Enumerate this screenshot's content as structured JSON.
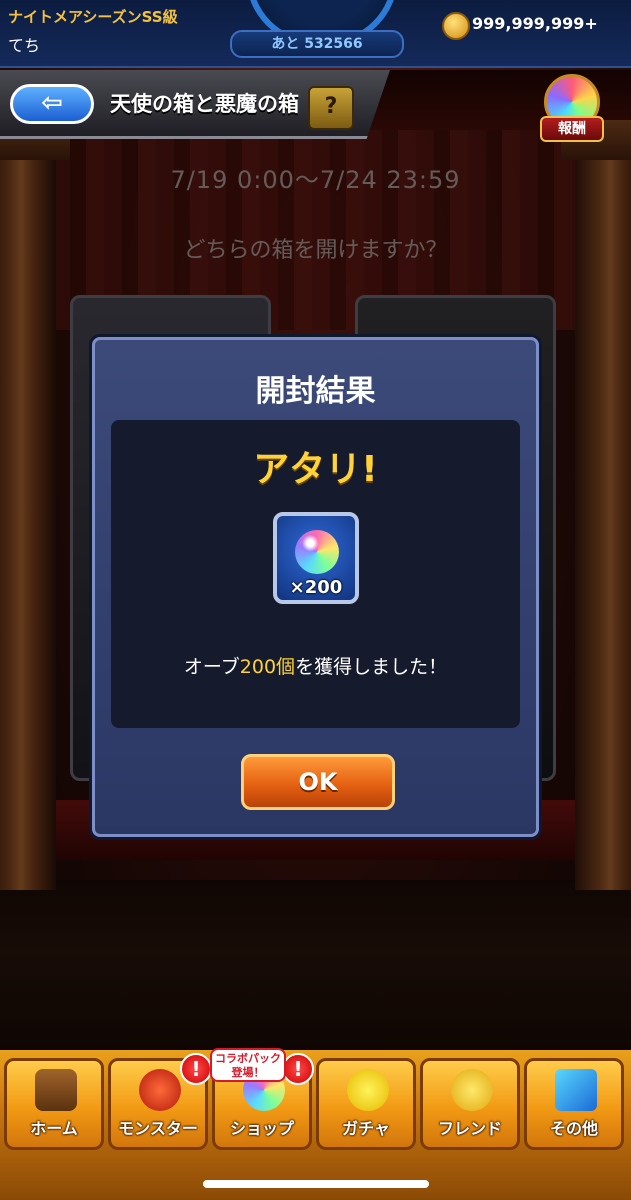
{
  "status": {
    "season": "ナイトメアシーズンSS級",
    "username": "てち",
    "rank_progress": "あと 532566",
    "coins": "999,999,999+"
  },
  "header": {
    "back_icon": "⇦",
    "title": "天使の箱と悪魔の箱",
    "help_icon": "?",
    "reward_label": "報酬"
  },
  "event": {
    "period": "7/19 0:00〜7/24 23:59",
    "question": "どちらの箱を開けますか？"
  },
  "modal": {
    "title": "開封結果",
    "result_heading": "アタリ!",
    "item_quantity": "×200",
    "message_prefix": "オーブ",
    "message_highlight": "200個",
    "message_suffix": "を獲得しました！",
    "ok_label": "OK"
  },
  "nav": {
    "items": [
      {
        "label": "ホーム"
      },
      {
        "label": "モンスター"
      },
      {
        "label": "ショップ"
      },
      {
        "label": "ガチャ"
      },
      {
        "label": "フレンド"
      },
      {
        "label": "その他"
      }
    ],
    "alert_mark": "!",
    "collab_line1": "コラボパック",
    "collab_line2": "登場！"
  },
  "colors": {
    "accent_gold": "#ffd23a",
    "ok_orange": "#e25d10",
    "modal_blue": "#2b3763"
  }
}
